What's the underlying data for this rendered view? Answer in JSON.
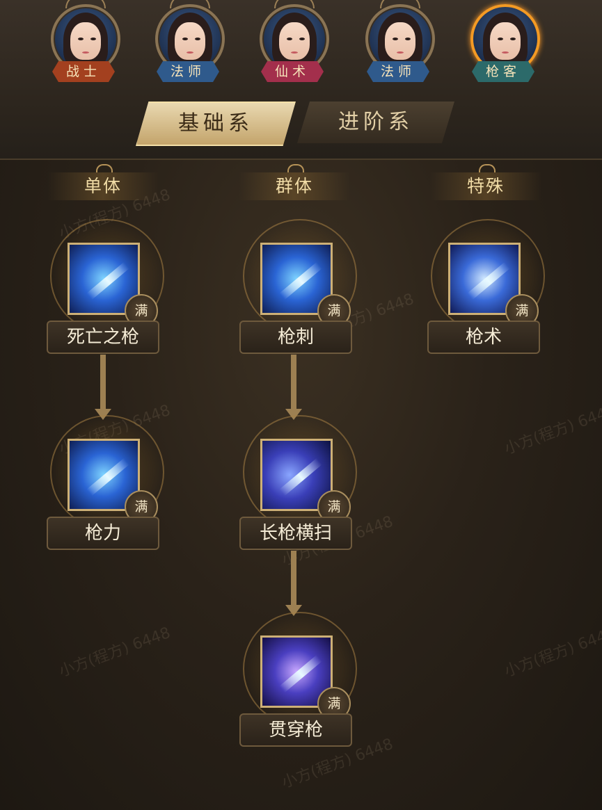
{
  "characters": [
    {
      "class_label": "战士",
      "tag_color": "#a3401f",
      "selected": false
    },
    {
      "class_label": "法师",
      "tag_color": "#2f5a8c",
      "selected": false
    },
    {
      "class_label": "仙术",
      "tag_color": "#a32f4c",
      "selected": false
    },
    {
      "class_label": "法师",
      "tag_color": "#2f5a8c",
      "selected": false
    },
    {
      "class_label": "枪客",
      "tag_color": "#2c6a6a",
      "selected": true
    }
  ],
  "tabs": {
    "basic": "基础系",
    "advanced": "进阶系",
    "active": "basic"
  },
  "columns": {
    "single": "单体",
    "group": "群体",
    "special": "特殊"
  },
  "skills": {
    "death_spear": {
      "name": "死亡之枪",
      "badge": "满",
      "icon": "spear-thrust-icon"
    },
    "spear_power": {
      "name": "枪力",
      "badge": "满",
      "icon": "spear-swirl-icon"
    },
    "spear_stab": {
      "name": "枪刺",
      "badge": "满",
      "icon": "spear-wind-icon"
    },
    "long_spear_sweep": {
      "name": "长枪横扫",
      "badge": "满",
      "icon": "sweep-arc-icon"
    },
    "piercing_spear": {
      "name": "贯穿枪",
      "badge": "满",
      "icon": "triple-blade-icon"
    },
    "spear_art": {
      "name": "枪术",
      "badge": "满",
      "icon": "crystal-spear-icon"
    }
  },
  "watermark": "小方(程方) 6448",
  "colors": {
    "accent": "#f39a24",
    "gold": "#cdb076"
  }
}
